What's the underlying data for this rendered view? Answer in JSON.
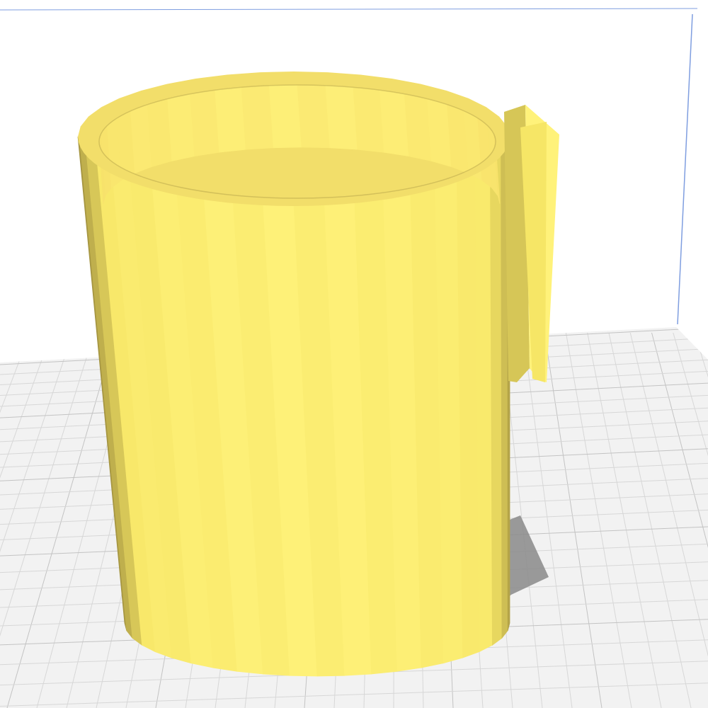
{
  "viewport": {
    "view": "3d-model-preview",
    "background_color": "#ffffff",
    "build_volume_edge_color": "#7f9ee0",
    "build_plate_color": "#f2f2f2",
    "grid_minor_color": "#d7d7d7",
    "grid_major_color": "#c3c3c3",
    "shadow_color": "#8a8a8a"
  },
  "model": {
    "shape": "mug-with-handle",
    "segments": 22,
    "base_color": "#f6e666",
    "light_color": "#fff27a",
    "dark_color": "#9a8a3c",
    "rim_color": "#f2de6a",
    "interior_color": "#f7e16a"
  }
}
